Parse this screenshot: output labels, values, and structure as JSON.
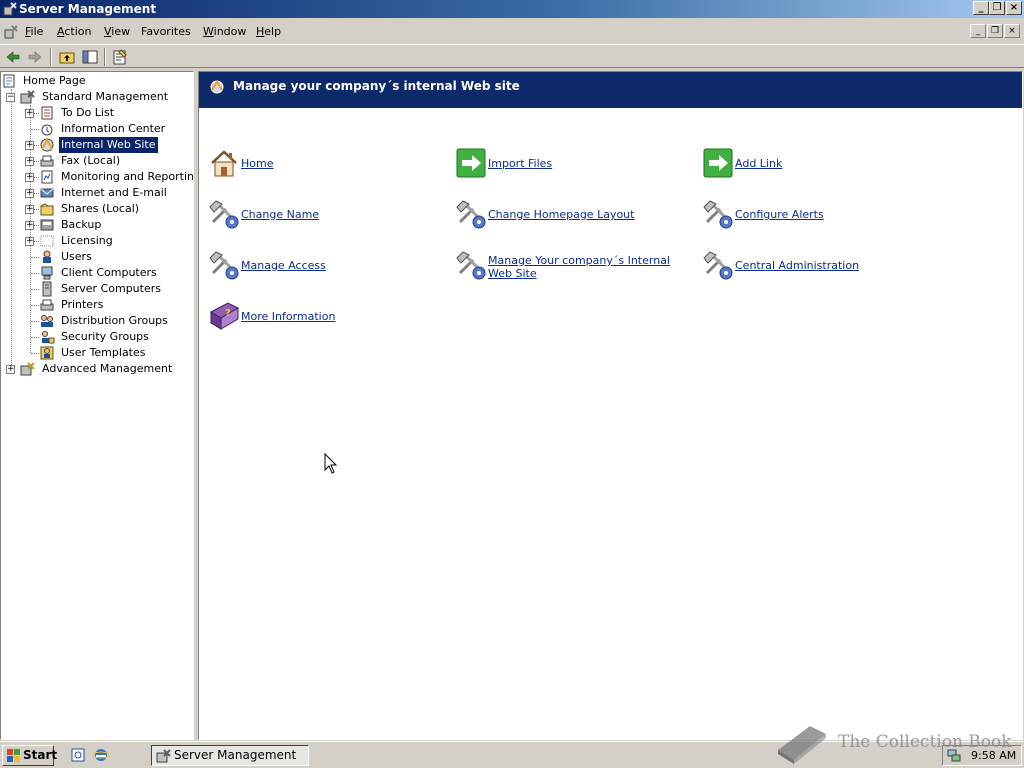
{
  "window": {
    "title": "Server Management"
  },
  "menubar": {
    "items": [
      {
        "label": "File",
        "accel": "F",
        "rest": "ile"
      },
      {
        "label": "Action",
        "accel": "A",
        "rest": "ction"
      },
      {
        "label": "View",
        "accel": "V",
        "rest": "iew"
      },
      {
        "label": "Favorites",
        "accel": "",
        "rest": "Favorites"
      },
      {
        "label": "Window",
        "accel": "W",
        "rest": "indow"
      },
      {
        "label": "Help",
        "accel": "H",
        "rest": "elp"
      }
    ]
  },
  "tree": {
    "root": "Home Page",
    "standard": "Standard Management",
    "children": [
      {
        "label": "To Do List",
        "icon": "todo-list-icon"
      },
      {
        "label": "Information Center",
        "icon": "information-center-icon"
      },
      {
        "label": "Internal Web Site",
        "icon": "internal-web-site-icon"
      },
      {
        "label": "Fax (Local)",
        "icon": "fax-icon"
      },
      {
        "label": "Monitoring and Reporting",
        "icon": "monitoring-icon"
      },
      {
        "label": "Internet and E-mail",
        "icon": "internet-email-icon"
      },
      {
        "label": "Shares (Local)",
        "icon": "shares-icon"
      },
      {
        "label": "Backup",
        "icon": "backup-icon"
      },
      {
        "label": "Licensing",
        "icon": "licensing-icon"
      },
      {
        "label": "Users",
        "icon": "users-icon"
      },
      {
        "label": "Client Computers",
        "icon": "client-computers-icon"
      },
      {
        "label": "Server Computers",
        "icon": "server-computers-icon"
      },
      {
        "label": "Printers",
        "icon": "printers-icon"
      },
      {
        "label": "Distribution Groups",
        "icon": "distribution-groups-icon"
      },
      {
        "label": "Security Groups",
        "icon": "security-groups-icon"
      },
      {
        "label": "User Templates",
        "icon": "user-templates-icon"
      }
    ],
    "advanced": "Advanced Management"
  },
  "content": {
    "header": "Manage your company´s internal Web site",
    "tasks": [
      {
        "label": "Home",
        "icon": "home-icon"
      },
      {
        "label": "Import Files",
        "icon": "arrow-right-icon"
      },
      {
        "label": "Add Link",
        "icon": "arrow-right-icon"
      },
      {
        "label": "Change Name",
        "icon": "tools-icon"
      },
      {
        "label": "Change Homepage Layout",
        "icon": "tools-icon"
      },
      {
        "label": "Configure Alerts",
        "icon": "tools-icon"
      },
      {
        "label": "Manage Access",
        "icon": "tools-icon"
      },
      {
        "label": "Manage Your company´s Internal Web Site",
        "icon": "tools-icon"
      },
      {
        "label": "Central Administration",
        "icon": "tools-icon"
      },
      {
        "label": "More Information",
        "icon": "help-book-icon"
      }
    ]
  },
  "taskbar": {
    "start": "Start",
    "task": "Server Management",
    "clock": "9:58 AM"
  },
  "watermark": "The Collection Book",
  "colors": {
    "header_bg": "#0f2a6b",
    "link": "#0a2c8e",
    "selection": "#0a246a"
  }
}
